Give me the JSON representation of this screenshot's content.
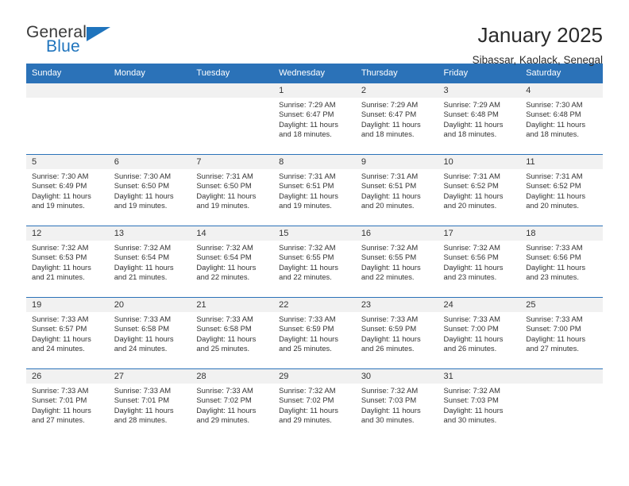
{
  "logo": {
    "word_one": "General",
    "word_two": "Blue",
    "triangle_icon": "blue-triangle-icon",
    "accent_color": "#1f74bd"
  },
  "header": {
    "title": "January 2025",
    "subtitle": "Sibassar, Kaolack, Senegal"
  },
  "theme": {
    "header_blue": "#2b72b8",
    "daynum_gray": "#f1f1f1",
    "text": "#333333"
  },
  "weekday_headers": [
    "Sunday",
    "Monday",
    "Tuesday",
    "Wednesday",
    "Thursday",
    "Friday",
    "Saturday"
  ],
  "weeks": [
    [
      {
        "day": "",
        "sunrise": "",
        "sunset": "",
        "daylight": "",
        "daylight2": ""
      },
      {
        "day": "",
        "sunrise": "",
        "sunset": "",
        "daylight": "",
        "daylight2": ""
      },
      {
        "day": "",
        "sunrise": "",
        "sunset": "",
        "daylight": "",
        "daylight2": ""
      },
      {
        "day": "1",
        "sunrise": "Sunrise: 7:29 AM",
        "sunset": "Sunset: 6:47 PM",
        "daylight": "Daylight: 11 hours",
        "daylight2": "and 18 minutes."
      },
      {
        "day": "2",
        "sunrise": "Sunrise: 7:29 AM",
        "sunset": "Sunset: 6:47 PM",
        "daylight": "Daylight: 11 hours",
        "daylight2": "and 18 minutes."
      },
      {
        "day": "3",
        "sunrise": "Sunrise: 7:29 AM",
        "sunset": "Sunset: 6:48 PM",
        "daylight": "Daylight: 11 hours",
        "daylight2": "and 18 minutes."
      },
      {
        "day": "4",
        "sunrise": "Sunrise: 7:30 AM",
        "sunset": "Sunset: 6:48 PM",
        "daylight": "Daylight: 11 hours",
        "daylight2": "and 18 minutes."
      }
    ],
    [
      {
        "day": "5",
        "sunrise": "Sunrise: 7:30 AM",
        "sunset": "Sunset: 6:49 PM",
        "daylight": "Daylight: 11 hours",
        "daylight2": "and 19 minutes."
      },
      {
        "day": "6",
        "sunrise": "Sunrise: 7:30 AM",
        "sunset": "Sunset: 6:50 PM",
        "daylight": "Daylight: 11 hours",
        "daylight2": "and 19 minutes."
      },
      {
        "day": "7",
        "sunrise": "Sunrise: 7:31 AM",
        "sunset": "Sunset: 6:50 PM",
        "daylight": "Daylight: 11 hours",
        "daylight2": "and 19 minutes."
      },
      {
        "day": "8",
        "sunrise": "Sunrise: 7:31 AM",
        "sunset": "Sunset: 6:51 PM",
        "daylight": "Daylight: 11 hours",
        "daylight2": "and 19 minutes."
      },
      {
        "day": "9",
        "sunrise": "Sunrise: 7:31 AM",
        "sunset": "Sunset: 6:51 PM",
        "daylight": "Daylight: 11 hours",
        "daylight2": "and 20 minutes."
      },
      {
        "day": "10",
        "sunrise": "Sunrise: 7:31 AM",
        "sunset": "Sunset: 6:52 PM",
        "daylight": "Daylight: 11 hours",
        "daylight2": "and 20 minutes."
      },
      {
        "day": "11",
        "sunrise": "Sunrise: 7:31 AM",
        "sunset": "Sunset: 6:52 PM",
        "daylight": "Daylight: 11 hours",
        "daylight2": "and 20 minutes."
      }
    ],
    [
      {
        "day": "12",
        "sunrise": "Sunrise: 7:32 AM",
        "sunset": "Sunset: 6:53 PM",
        "daylight": "Daylight: 11 hours",
        "daylight2": "and 21 minutes."
      },
      {
        "day": "13",
        "sunrise": "Sunrise: 7:32 AM",
        "sunset": "Sunset: 6:54 PM",
        "daylight": "Daylight: 11 hours",
        "daylight2": "and 21 minutes."
      },
      {
        "day": "14",
        "sunrise": "Sunrise: 7:32 AM",
        "sunset": "Sunset: 6:54 PM",
        "daylight": "Daylight: 11 hours",
        "daylight2": "and 22 minutes."
      },
      {
        "day": "15",
        "sunrise": "Sunrise: 7:32 AM",
        "sunset": "Sunset: 6:55 PM",
        "daylight": "Daylight: 11 hours",
        "daylight2": "and 22 minutes."
      },
      {
        "day": "16",
        "sunrise": "Sunrise: 7:32 AM",
        "sunset": "Sunset: 6:55 PM",
        "daylight": "Daylight: 11 hours",
        "daylight2": "and 22 minutes."
      },
      {
        "day": "17",
        "sunrise": "Sunrise: 7:32 AM",
        "sunset": "Sunset: 6:56 PM",
        "daylight": "Daylight: 11 hours",
        "daylight2": "and 23 minutes."
      },
      {
        "day": "18",
        "sunrise": "Sunrise: 7:33 AM",
        "sunset": "Sunset: 6:56 PM",
        "daylight": "Daylight: 11 hours",
        "daylight2": "and 23 minutes."
      }
    ],
    [
      {
        "day": "19",
        "sunrise": "Sunrise: 7:33 AM",
        "sunset": "Sunset: 6:57 PM",
        "daylight": "Daylight: 11 hours",
        "daylight2": "and 24 minutes."
      },
      {
        "day": "20",
        "sunrise": "Sunrise: 7:33 AM",
        "sunset": "Sunset: 6:58 PM",
        "daylight": "Daylight: 11 hours",
        "daylight2": "and 24 minutes."
      },
      {
        "day": "21",
        "sunrise": "Sunrise: 7:33 AM",
        "sunset": "Sunset: 6:58 PM",
        "daylight": "Daylight: 11 hours",
        "daylight2": "and 25 minutes."
      },
      {
        "day": "22",
        "sunrise": "Sunrise: 7:33 AM",
        "sunset": "Sunset: 6:59 PM",
        "daylight": "Daylight: 11 hours",
        "daylight2": "and 25 minutes."
      },
      {
        "day": "23",
        "sunrise": "Sunrise: 7:33 AM",
        "sunset": "Sunset: 6:59 PM",
        "daylight": "Daylight: 11 hours",
        "daylight2": "and 26 minutes."
      },
      {
        "day": "24",
        "sunrise": "Sunrise: 7:33 AM",
        "sunset": "Sunset: 7:00 PM",
        "daylight": "Daylight: 11 hours",
        "daylight2": "and 26 minutes."
      },
      {
        "day": "25",
        "sunrise": "Sunrise: 7:33 AM",
        "sunset": "Sunset: 7:00 PM",
        "daylight": "Daylight: 11 hours",
        "daylight2": "and 27 minutes."
      }
    ],
    [
      {
        "day": "26",
        "sunrise": "Sunrise: 7:33 AM",
        "sunset": "Sunset: 7:01 PM",
        "daylight": "Daylight: 11 hours",
        "daylight2": "and 27 minutes."
      },
      {
        "day": "27",
        "sunrise": "Sunrise: 7:33 AM",
        "sunset": "Sunset: 7:01 PM",
        "daylight": "Daylight: 11 hours",
        "daylight2": "and 28 minutes."
      },
      {
        "day": "28",
        "sunrise": "Sunrise: 7:33 AM",
        "sunset": "Sunset: 7:02 PM",
        "daylight": "Daylight: 11 hours",
        "daylight2": "and 29 minutes."
      },
      {
        "day": "29",
        "sunrise": "Sunrise: 7:32 AM",
        "sunset": "Sunset: 7:02 PM",
        "daylight": "Daylight: 11 hours",
        "daylight2": "and 29 minutes."
      },
      {
        "day": "30",
        "sunrise": "Sunrise: 7:32 AM",
        "sunset": "Sunset: 7:03 PM",
        "daylight": "Daylight: 11 hours",
        "daylight2": "and 30 minutes."
      },
      {
        "day": "31",
        "sunrise": "Sunrise: 7:32 AM",
        "sunset": "Sunset: 7:03 PM",
        "daylight": "Daylight: 11 hours",
        "daylight2": "and 30 minutes."
      },
      {
        "day": "",
        "sunrise": "",
        "sunset": "",
        "daylight": "",
        "daylight2": ""
      }
    ]
  ]
}
